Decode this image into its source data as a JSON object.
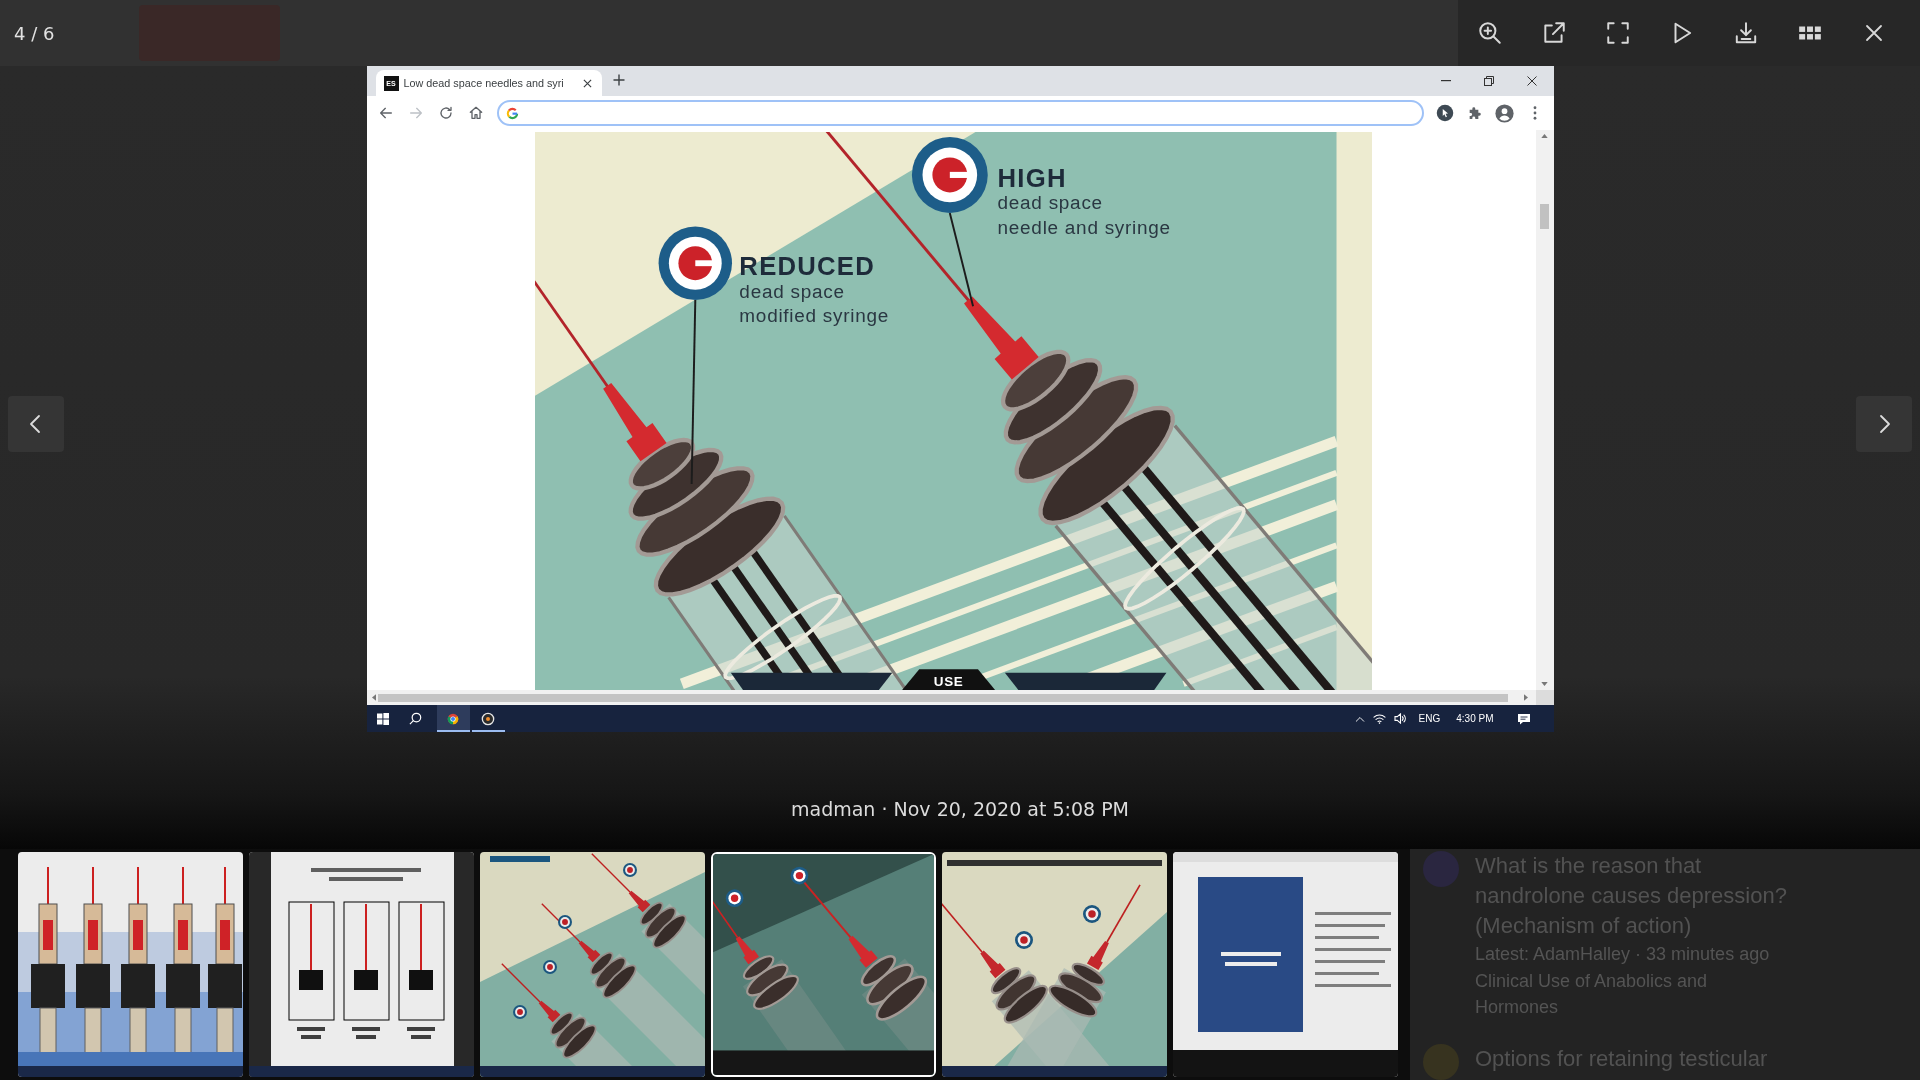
{
  "viewer": {
    "counter": "4 / 6",
    "caption": "madman · Nov 20, 2020 at 5:08 PM"
  },
  "browser": {
    "tab": {
      "favicon": "ES",
      "title": "Low dead space needles and syri"
    },
    "illustration": {
      "labels": [
        {
          "heading": "HIGH",
          "lines": [
            "dead space",
            "needle and syringe"
          ]
        },
        {
          "heading": "REDUCED",
          "lines": [
            "dead space",
            "modified syringe"
          ]
        }
      ],
      "banner": "USE"
    },
    "taskbar": {
      "language": "ENG",
      "time": "4:30 PM"
    }
  },
  "thumbnails": [
    {
      "kind": "syringe-chart",
      "selected": false
    },
    {
      "kind": "figure",
      "selected": false
    },
    {
      "kind": "poster",
      "selected": false
    },
    {
      "kind": "poster-dark",
      "selected": true
    },
    {
      "kind": "poster-light",
      "selected": false
    },
    {
      "kind": "document",
      "selected": false
    }
  ],
  "background_page": {
    "topics": [
      {
        "title": "What is the reason that nandrolone causes depression? (Mechanism of action)",
        "meta": "Latest: AdamHalley · 33 minutes ago",
        "forum": "Clinical Use of Anabolics and Hormones"
      },
      {
        "title": "Options for retaining testicular"
      }
    ]
  }
}
